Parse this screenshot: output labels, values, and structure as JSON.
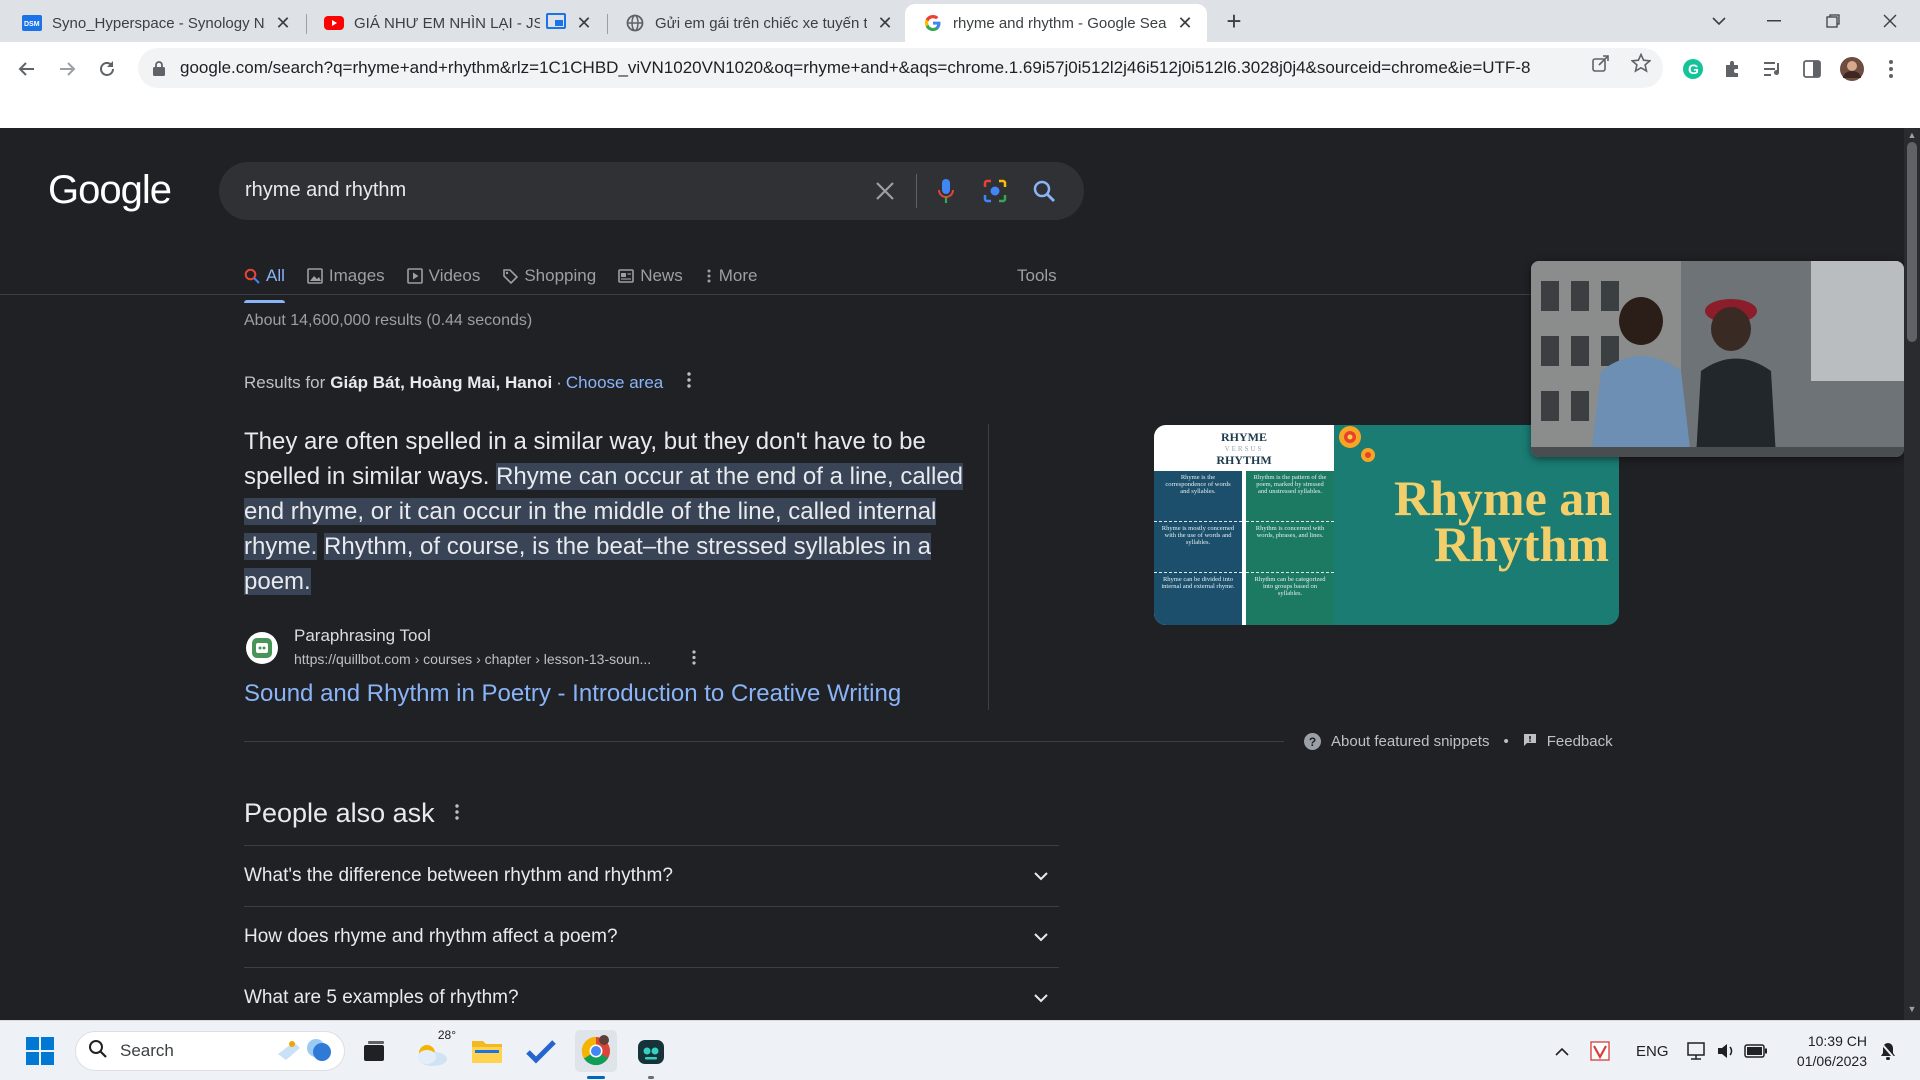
{
  "browser": {
    "tabs": [
      {
        "title": "Syno_Hyperspace - Synology NAS",
        "favicon": "synology-dsm-icon",
        "active": false
      },
      {
        "title": "GIÁ NHƯ EM NHÌN LẠI - JSOL",
        "favicon": "youtube-icon",
        "active": false,
        "pip_badge": "picture-in-picture-icon"
      },
      {
        "title": "Gửi em gái trên chiếc xe tuyến trắng",
        "favicon": "globe-icon",
        "active": false
      },
      {
        "title": "rhyme and rhythm - Google Search",
        "favicon": "google-g-icon",
        "active": true
      }
    ],
    "new_tab": "+",
    "url": "google.com/search?q=rhyme+and+rhythm&rlz=1C1CHBD_viVN1020VN1020&oq=rhyme+and+&aqs=chrome.1.69i57j0i512l2j46i512j0i512l6.3028j0j4&sourceid=chrome&ie=UTF-8"
  },
  "google": {
    "logo": "Google",
    "query": "rhyme and rhythm",
    "tabs": [
      {
        "label": "All",
        "icon": "search-icon",
        "active": true
      },
      {
        "label": "Images",
        "icon": "image-icon",
        "active": false
      },
      {
        "label": "Videos",
        "icon": "play-icon",
        "active": false
      },
      {
        "label": "Shopping",
        "icon": "tag-icon",
        "active": false
      },
      {
        "label": "News",
        "icon": "news-icon",
        "active": false
      },
      {
        "label": "More",
        "icon": "more-vert-icon",
        "active": false
      }
    ],
    "tools": "Tools",
    "stats": "About 14,600,000 results (0.44 seconds)",
    "location": {
      "prefix": "Results for",
      "place": "Giáp Bát, Hoàng Mai, Hanoi",
      "separator": "·",
      "link": "Choose area"
    },
    "snippet": {
      "plain": "They are often spelled in a similar way, but they don't have to be spelled in similar ways.",
      "highlight1": "Rhyme can occur at the end of a line, called end rhyme, or it can occur in the middle of the line, called internal rhyme.",
      "highlight2": "Rhythm, of course, is the beat–the stressed syllables in a poem."
    },
    "source": {
      "name": "Paraphrasing Tool",
      "url": "https://quillbot.com › courses › chapter › lesson-13-soun...",
      "title": "Sound and Rhythm in Poetry - Introduction to Creative Writing"
    },
    "image_card": {
      "infographic": {
        "title1": "RHYME",
        "title2": "VERSUS",
        "title3": "RHYTHM",
        "left": [
          "Rhyme is the correspondence of words and syllables.",
          "Rhyme is mostly concerned with the use of words and syllables.",
          "Rhyme can be divided into internal and external rhyme."
        ],
        "right": [
          "Rhythm is the pattern of the poem, marked by stressed and unstressed syllables.",
          "Rhythm is concerned with words, phrases, and lines.",
          "Rhythm can be categorized into groups based on syllables."
        ],
        "left_color": "#1b4f6b",
        "right_color": "#1c7a63"
      },
      "title_line1": "Rhyme an",
      "title_line2": "Rhythm",
      "bg_color": "#1a7c73",
      "title_color": "#f2cf6b"
    },
    "about_snippets": "About featured snippets",
    "bullet": "•",
    "feedback": "Feedback",
    "paa": {
      "title": "People also ask",
      "questions": [
        "What's the difference between rhythm and rhythm?",
        "How does rhyme and rhythm affect a poem?",
        "What are 5 examples of rhythm?"
      ]
    }
  },
  "taskbar": {
    "search_label": "Search",
    "weather_temp": "28°",
    "lang": "ENG",
    "time": "10:39 CH",
    "date": "01/06/2023"
  }
}
